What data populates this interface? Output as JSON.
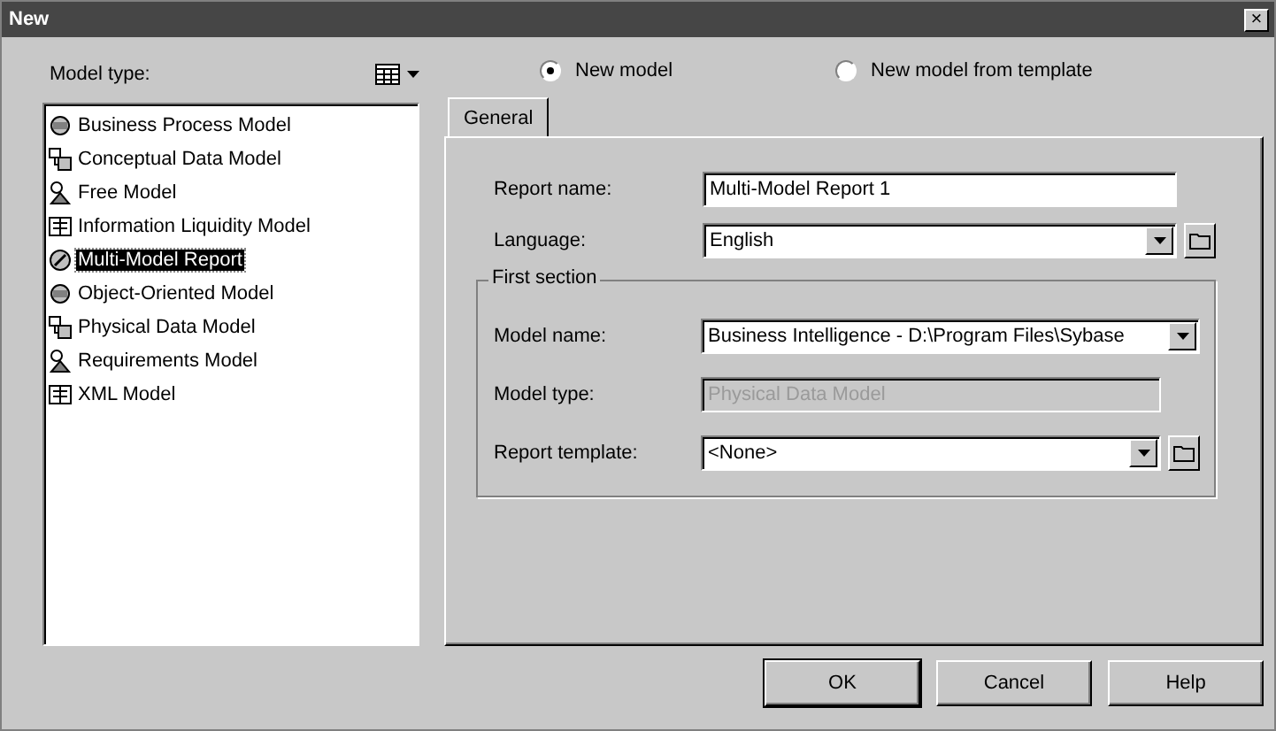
{
  "window": {
    "title": "New",
    "close": "×"
  },
  "model_type": {
    "label": "Model type:",
    "items": [
      {
        "label": "Business Process Model",
        "selected": false
      },
      {
        "label": "Conceptual Data Model",
        "selected": false
      },
      {
        "label": "Free Model",
        "selected": false
      },
      {
        "label": "Information Liquidity Model",
        "selected": false
      },
      {
        "label": "Multi-Model Report",
        "selected": true
      },
      {
        "label": "Object-Oriented Model",
        "selected": false
      },
      {
        "label": "Physical Data Model",
        "selected": false
      },
      {
        "label": "Requirements Model",
        "selected": false
      },
      {
        "label": "XML Model",
        "selected": false
      }
    ]
  },
  "mode": [
    {
      "label": "New model",
      "selected": true
    },
    {
      "label": "New model from template",
      "selected": false
    }
  ],
  "tabs": [
    {
      "label": "General",
      "selected": true
    }
  ],
  "fields": [
    {
      "label": "Report name:",
      "kind": "text",
      "value": "Multi-Model Report 1",
      "disabled": false,
      "browse": false
    },
    {
      "label": "Language:",
      "kind": "combo",
      "value": "English",
      "disabled": false,
      "browse": true
    }
  ],
  "first_section": {
    "title": "First section",
    "fields": [
      {
        "label": "Model name:",
        "kind": "combo",
        "value": "Business Intelligence - D:\\Program Files\\Sybase",
        "disabled": false,
        "browse": false
      },
      {
        "label": "Model type:",
        "kind": "text",
        "value": "Physical Data Model",
        "disabled": true,
        "browse": false
      },
      {
        "label": "Report template:",
        "kind": "combo",
        "value": "<None>",
        "disabled": false,
        "browse": true
      }
    ]
  },
  "buttons": [
    {
      "label": "OK",
      "default": true
    },
    {
      "label": "Cancel",
      "default": false
    },
    {
      "label": "Help",
      "default": false
    }
  ]
}
